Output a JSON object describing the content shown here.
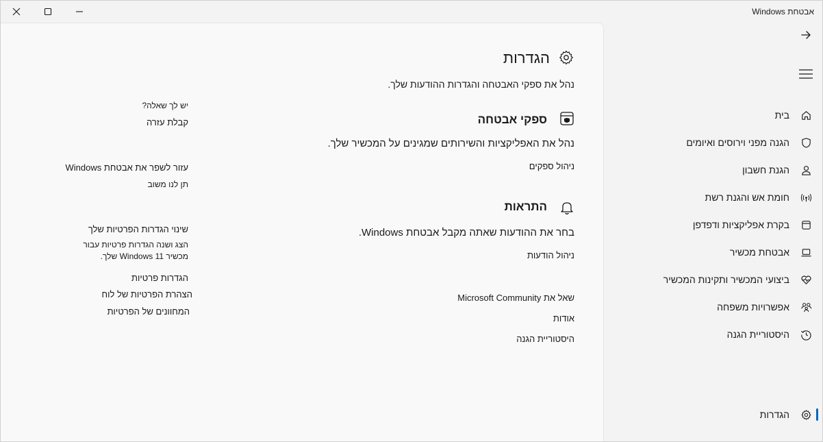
{
  "window": {
    "title": "אבטחת Windows"
  },
  "nav": {
    "items": [
      {
        "label": "בית",
        "icon": "home-icon"
      },
      {
        "label": "הגנה מפני וירוסים ואיומים",
        "icon": "shield-icon"
      },
      {
        "label": "הגנת חשבון",
        "icon": "person-icon"
      },
      {
        "label": "חומת אש והגנת רשת",
        "icon": "wifi-signal-icon"
      },
      {
        "label": "בקרת אפליקציות ודפדפן",
        "icon": "app-window-icon"
      },
      {
        "label": "אבטחת מכשיר",
        "icon": "laptop-icon"
      },
      {
        "label": "ביצועי המכשיר ותקינות המכשיר",
        "icon": "heart-pulse-icon"
      },
      {
        "label": "אפשרויות משפחה",
        "icon": "family-icon"
      },
      {
        "label": "היסטוריית הגנה",
        "icon": "history-icon"
      }
    ],
    "settings_label": "הגדרות"
  },
  "page": {
    "title": "הגדרות",
    "subtitle": "נהל את ספקי האבטחה והגדרות ההודעות שלך.",
    "providers": {
      "heading": "ספקי אבטחה",
      "description": "נהל את האפליקציות והשירותים שמגינים על המכשיר שלך.",
      "link": "ניהול ספקים"
    },
    "notifications": {
      "heading": "התראות",
      "description": "בחר את ההודעות שאתה מקבל אבטחת Windows.",
      "link": "ניהול הודעות"
    },
    "links": {
      "community": "שאל את Microsoft Community",
      "about": "אודות",
      "history": "היסטוריית הגנה"
    }
  },
  "side": {
    "question": {
      "heading": "יש לך שאלה?",
      "link": "קבלת עזרה"
    },
    "improve": {
      "heading": "עזור לשפר את אבטחת Windows",
      "link": "תן לנו משוב"
    },
    "privacy": {
      "heading": "שינוי הגדרות הפרטיות שלך",
      "desc_line1": "הצג ושנה הגדרות פרטיות עבור",
      "desc_line2": "מכשיר Windows 11 שלך.",
      "link1": "הגדרות פרטיות",
      "link2": "הצהרת הפרטיות של לוח",
      "link3": "המחוונים של הפרטיות"
    }
  }
}
